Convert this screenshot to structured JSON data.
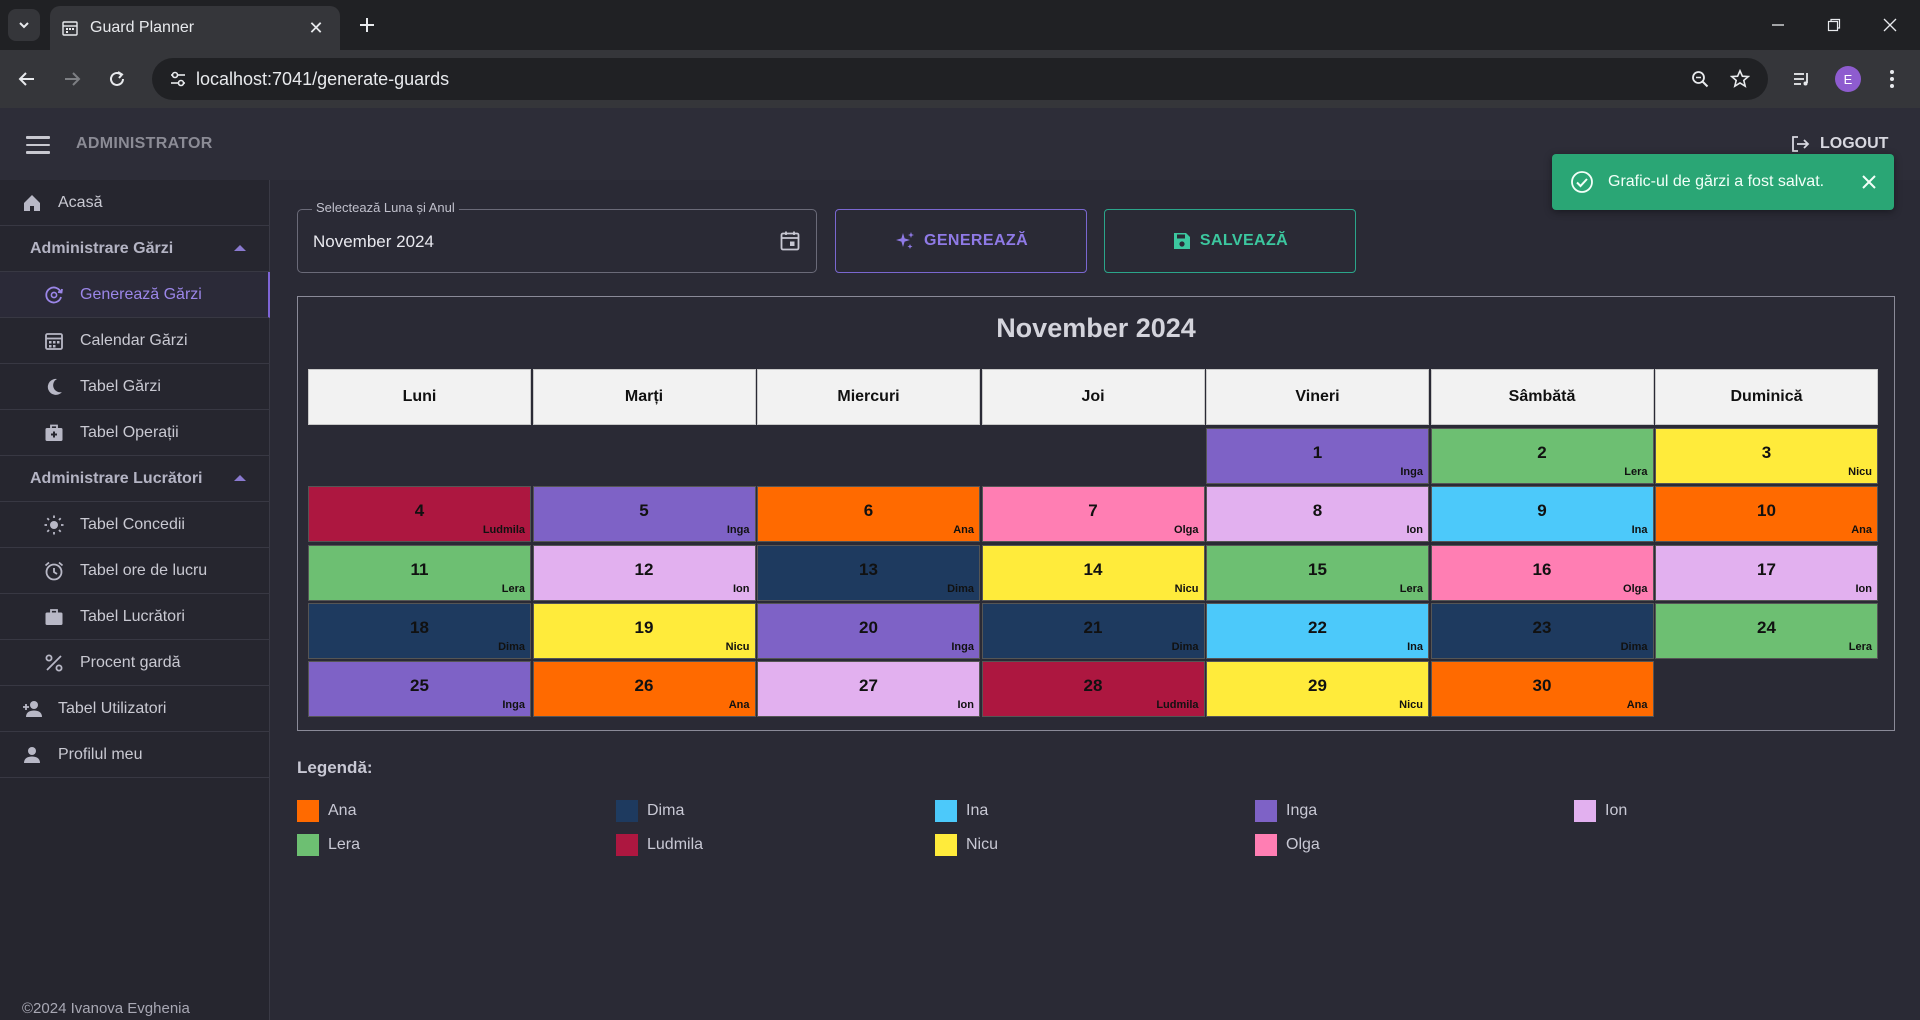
{
  "browser": {
    "tab_title": "Guard Planner",
    "url": "localhost:7041/generate-guards",
    "profile_initial": "E"
  },
  "header": {
    "role": "ADMINISTRATOR",
    "logout": "LOGOUT"
  },
  "sidebar": {
    "home": "Acasă",
    "group_guards": "Administrare Gărzi",
    "generate": "Generează Gărzi",
    "calendar": "Calendar Gărzi",
    "guards_table": "Tabel Gărzi",
    "operations_table": "Tabel Operații",
    "group_workers": "Administrare Lucrători",
    "leave_table": "Tabel Concedii",
    "hours_table": "Tabel ore de lucru",
    "workers_table": "Tabel Lucrători",
    "guard_percent": "Procent gardă",
    "users_table": "Tabel Utilizatori",
    "profile": "Profilul meu",
    "footer": "©2024 Ivanova Evghenia"
  },
  "picker": {
    "label": "Selectează Luna și Anul",
    "value": "November 2024"
  },
  "actions": {
    "generate": "GENEREAZĂ",
    "save": "SALVEAZĂ"
  },
  "toast": {
    "message": "Grafic-ul de gărzi a fost salvat."
  },
  "calendar": {
    "title": "November 2024",
    "weekdays": [
      "Luni",
      "Marți",
      "Miercuri",
      "Joi",
      "Vineri",
      "Sâmbătă",
      "Duminică"
    ],
    "first_weekday_index": 4,
    "days": [
      {
        "day": "1",
        "name": "Inga"
      },
      {
        "day": "2",
        "name": "Lera"
      },
      {
        "day": "3",
        "name": "Nicu"
      },
      {
        "day": "4",
        "name": "Ludmila"
      },
      {
        "day": "5",
        "name": "Inga"
      },
      {
        "day": "6",
        "name": "Ana"
      },
      {
        "day": "7",
        "name": "Olga"
      },
      {
        "day": "8",
        "name": "Ion"
      },
      {
        "day": "9",
        "name": "Ina"
      },
      {
        "day": "10",
        "name": "Ana"
      },
      {
        "day": "11",
        "name": "Lera"
      },
      {
        "day": "12",
        "name": "Ion"
      },
      {
        "day": "13",
        "name": "Dima"
      },
      {
        "day": "14",
        "name": "Nicu"
      },
      {
        "day": "15",
        "name": "Lera"
      },
      {
        "day": "16",
        "name": "Olga"
      },
      {
        "day": "17",
        "name": "Ion"
      },
      {
        "day": "18",
        "name": "Dima"
      },
      {
        "day": "19",
        "name": "Nicu"
      },
      {
        "day": "20",
        "name": "Inga"
      },
      {
        "day": "21",
        "name": "Dima"
      },
      {
        "day": "22",
        "name": "Ina"
      },
      {
        "day": "23",
        "name": "Dima"
      },
      {
        "day": "24",
        "name": "Lera"
      },
      {
        "day": "25",
        "name": "Inga"
      },
      {
        "day": "26",
        "name": "Ana"
      },
      {
        "day": "27",
        "name": "Ion"
      },
      {
        "day": "28",
        "name": "Ludmila"
      },
      {
        "day": "29",
        "name": "Nicu"
      },
      {
        "day": "30",
        "name": "Ana"
      }
    ]
  },
  "legend": {
    "title": "Legendă:",
    "items": [
      {
        "name": "Ana",
        "color": "#ff6a00"
      },
      {
        "name": "Dima",
        "color": "#1e3a5f"
      },
      {
        "name": "Ina",
        "color": "#4cc9fa"
      },
      {
        "name": "Inga",
        "color": "#7e62c6"
      },
      {
        "name": "Ion",
        "color": "#e2b0ef"
      },
      {
        "name": "Lera",
        "color": "#6dbf72"
      },
      {
        "name": "Ludmila",
        "color": "#ad1740"
      },
      {
        "name": "Nicu",
        "color": "#ffeb3b"
      },
      {
        "name": "Olga",
        "color": "#ff7eb3"
      }
    ]
  },
  "colors": {
    "accent": "#8f7ae6",
    "success": "#2aa675"
  }
}
